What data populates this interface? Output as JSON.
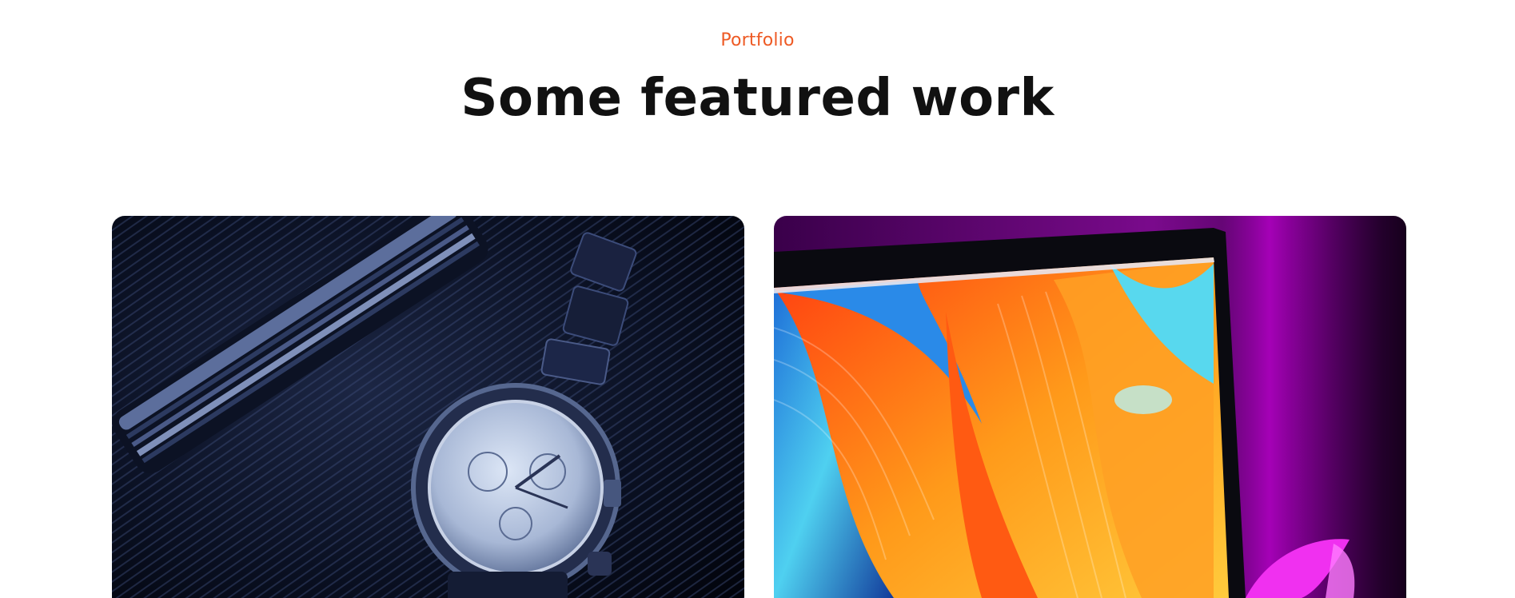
{
  "section": {
    "eyebrow": "Portfolio",
    "title": "Some featured work"
  },
  "portfolio": {
    "items": [
      {
        "image": "watch-and-pocketknife-photo"
      },
      {
        "image": "laptop-colorful-wallpaper-photo"
      }
    ]
  },
  "colors": {
    "accent": "#ee5a24",
    "heading": "#111111",
    "background": "#ffffff"
  }
}
